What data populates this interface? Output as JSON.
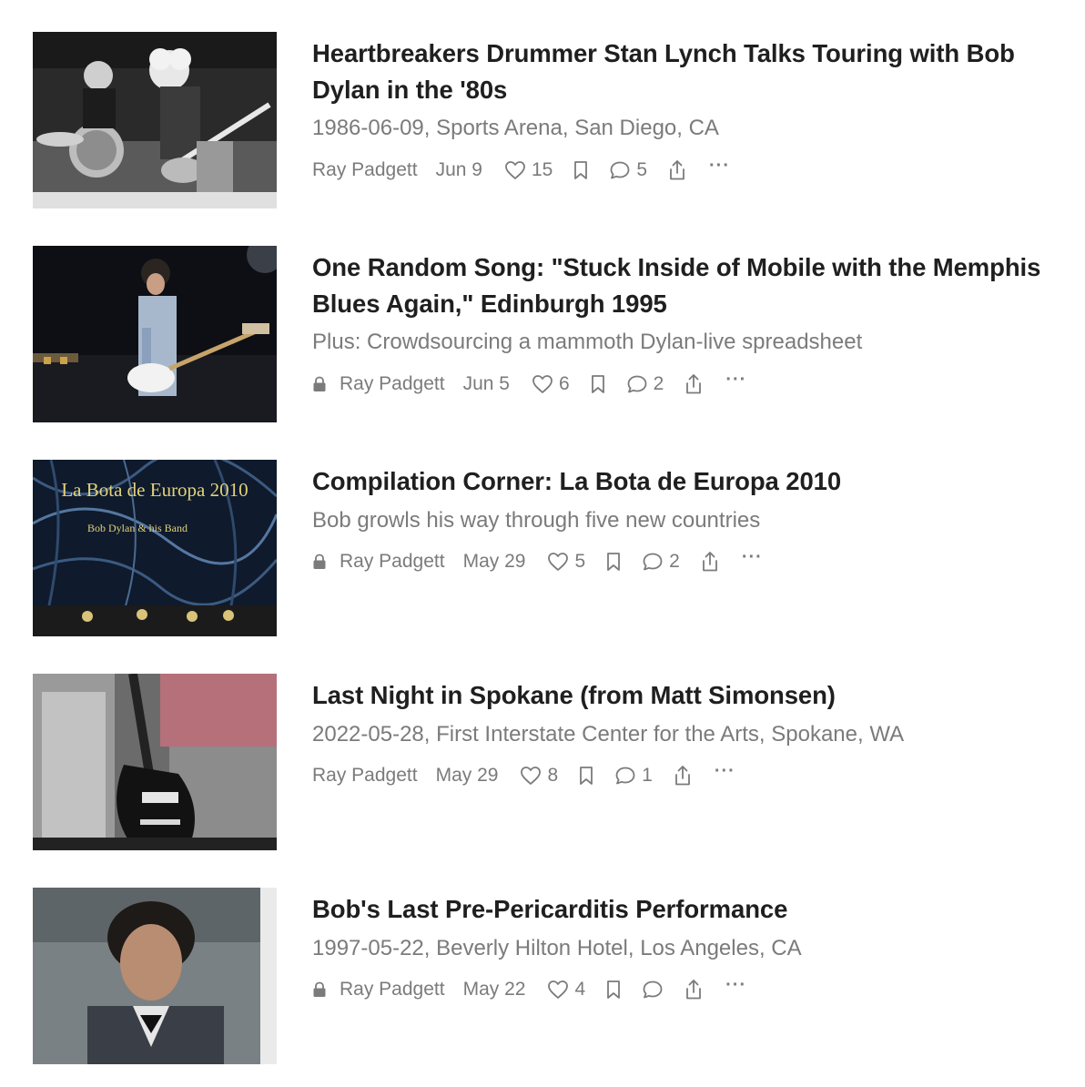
{
  "posts": [
    {
      "title": "Heartbreakers Drummer Stan Lynch Talks Touring with Bob Dylan in the '80s",
      "subtitle": "1986-06-09, Sports Arena, San Diego, CA",
      "locked": false,
      "author": "Ray Padgett",
      "date": "Jun 9",
      "likes": "15",
      "comments": "5",
      "image_icon": "concert-photo-drummer-guitarist-bw"
    },
    {
      "title": "One Random Song: \"Stuck Inside of Mobile with the Memphis Blues Again,\" Edinburgh 1995",
      "subtitle": "Plus: Crowdsourcing a mammoth Dylan-live spreadsheet",
      "locked": true,
      "author": "Ray Padgett",
      "date": "Jun 5",
      "likes": "6",
      "comments": "2",
      "image_icon": "concert-photo-guitarist-stage"
    },
    {
      "title": "Compilation Corner: La Bota de Europa 2010",
      "subtitle": "Bob growls his way through five new countries",
      "locked": true,
      "author": "Ray Padgett",
      "date": "May 29",
      "likes": "5",
      "comments": "2",
      "image_icon": "album-cover",
      "image_text": {
        "line1": "La Bota de Europa 2010",
        "line2": "Bob Dylan & his Band"
      }
    },
    {
      "title": "Last Night in Spokane (from Matt Simonsen)",
      "subtitle": "2022-05-28, First Interstate Center for the Arts, Spokane, WA",
      "locked": false,
      "author": "Ray Padgett",
      "date": "May 29",
      "likes": "8",
      "comments": "1",
      "image_icon": "guitar-and-amp-photo"
    },
    {
      "title": "Bob's Last Pre-Pericarditis Performance",
      "subtitle": "1997-05-22, Beverly Hilton Hotel, Los Angeles, CA",
      "locked": true,
      "author": "Ray Padgett",
      "date": "May 22",
      "likes": "4",
      "comments": "",
      "image_icon": "portrait-photo"
    }
  ],
  "more_label": "···",
  "colors": {
    "title": "#1f1f1f",
    "muted": "#7b7b7b",
    "background": "#ffffff"
  }
}
